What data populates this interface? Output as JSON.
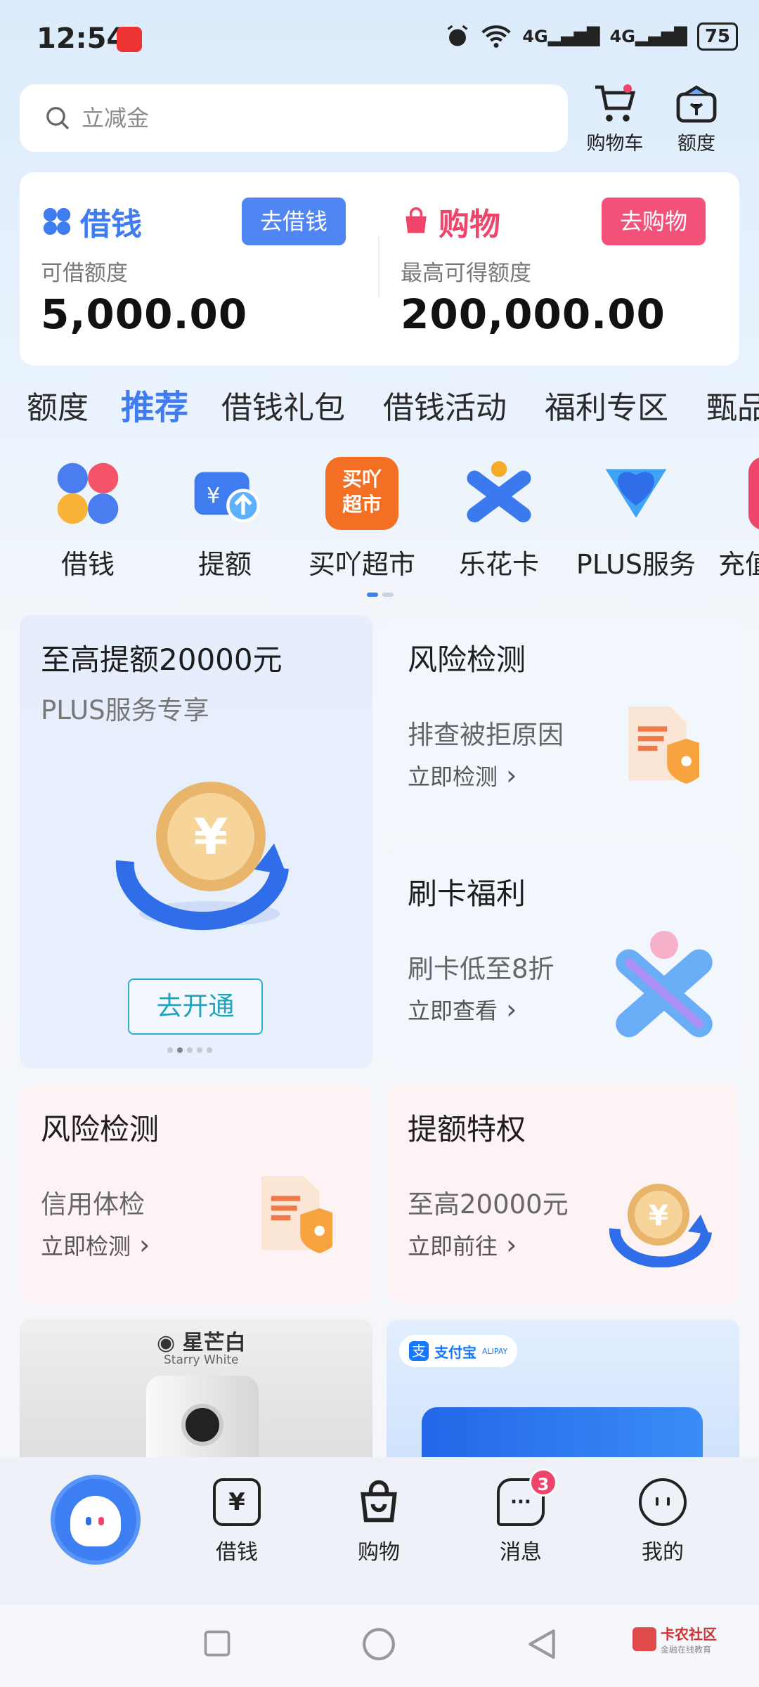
{
  "status_bar": {
    "time": "12:54",
    "network_1": "4G",
    "network_2": "4G",
    "battery": "75"
  },
  "search": {
    "placeholder": "立减金"
  },
  "top_actions": {
    "cart_label": "购物车",
    "quota_label": "额度"
  },
  "borrow_card": {
    "title": "借钱",
    "button": "去借钱",
    "subtitle": "可借额度",
    "amount": "5,000.00"
  },
  "shop_card": {
    "title": "购物",
    "button": "去购物",
    "subtitle": "最高可得额度",
    "amount": "200,000.00"
  },
  "category_tabs": [
    "额度",
    "推荐",
    "借钱礼包",
    "借钱活动",
    "福利专区",
    "甄品"
  ],
  "quick_nav": [
    {
      "label": "借钱",
      "icon": "clover-icon"
    },
    {
      "label": "提额",
      "icon": "raise-quota-icon"
    },
    {
      "label": "买吖超市",
      "icon": "supermarket-icon",
      "icon_text": "买吖\n超市"
    },
    {
      "label": "乐花卡",
      "icon": "lehua-card-icon"
    },
    {
      "label": "PLUS服务",
      "icon": "plus-service-icon"
    },
    {
      "label": "充值",
      "icon": "recharge-icon"
    }
  ],
  "promo_main": {
    "title": "至高提额20000元",
    "subtitle": "PLUS服务专享",
    "button": "去开通",
    "currency_symbol": "¥"
  },
  "tiles": {
    "risk_check_1": {
      "title": "风险检测",
      "subtitle": "排查被拒原因",
      "link": "立即检测"
    },
    "card_benefit": {
      "title": "刷卡福利",
      "subtitle": "刷卡低至8折",
      "link": "立即查看"
    },
    "risk_check_2": {
      "title": "风险检测",
      "subtitle": "信用体检",
      "link": "立即检测"
    },
    "quota_privilege": {
      "title": "提额特权",
      "subtitle": "至高20000元",
      "link": "立即前往",
      "currency_symbol": "¥"
    }
  },
  "banners": {
    "phone_label": "星芒白",
    "phone_label_en": "Starry White",
    "alipay_cn": "支付宝",
    "alipay_en": "ALIPAY"
  },
  "bottom_nav": {
    "borrow": {
      "label": "借钱",
      "icon_char": "¥"
    },
    "shop": {
      "label": "购物"
    },
    "messages": {
      "label": "消息",
      "badge": "3",
      "icon_char": "···"
    },
    "mine": {
      "label": "我的"
    }
  },
  "watermark": {
    "text": "卡农社区",
    "subtext": "金融在线教育"
  },
  "colors": {
    "accent_blue": "#3f7cf0",
    "accent_pink": "#f0456a",
    "borrow_button": "#4f86f4",
    "shop_button": "#f2527a"
  }
}
